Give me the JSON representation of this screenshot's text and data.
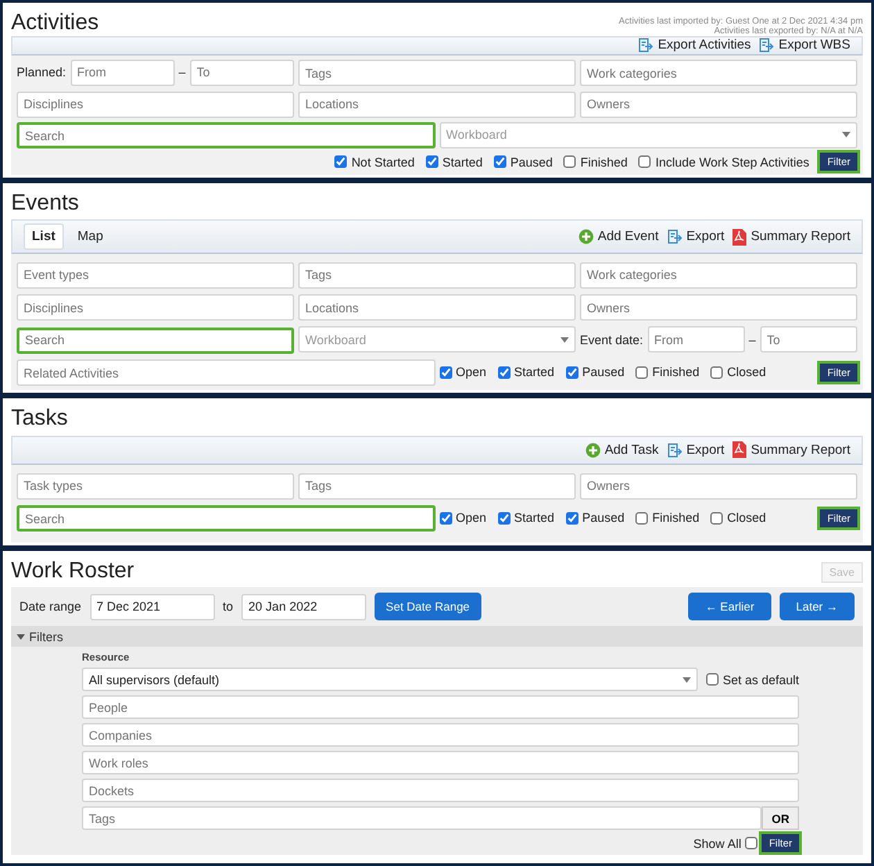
{
  "activities": {
    "title": "Activities",
    "notes": [
      "Activities last imported by: Guest One at 2 Dec 2021 4:34 pm",
      "Activities last exported by: N/A at N/A"
    ],
    "actions": [
      {
        "kind": "export",
        "label": "Export Activities"
      },
      {
        "kind": "export",
        "label": "Export WBS"
      }
    ],
    "planned_label": "Planned:",
    "dash": "–",
    "planned_from": {
      "placeholder": "From"
    },
    "planned_to": {
      "placeholder": "To"
    },
    "tags": {
      "placeholder": "Tags"
    },
    "work_categories": {
      "placeholder": "Work categories"
    },
    "disciplines": {
      "placeholder": "Disciplines"
    },
    "locations": {
      "placeholder": "Locations"
    },
    "owners": {
      "placeholder": "Owners"
    },
    "search": {
      "placeholder": "Search",
      "highlighted": true
    },
    "workboard": {
      "placeholder": "Workboard"
    },
    "statuses": [
      {
        "label": "Not Started",
        "checked": true
      },
      {
        "label": "Started",
        "checked": true
      },
      {
        "label": "Paused",
        "checked": true
      },
      {
        "label": "Finished",
        "checked": false
      },
      {
        "label": "Include Work Step Activities",
        "checked": false
      }
    ],
    "filter": {
      "label": "Filter",
      "highlighted": true
    }
  },
  "events": {
    "title": "Events",
    "views": [
      {
        "label": "List",
        "selected": true
      },
      {
        "label": "Map",
        "selected": false
      }
    ],
    "actions": [
      {
        "kind": "add",
        "label": "Add Event"
      },
      {
        "kind": "export",
        "label": "Export"
      },
      {
        "kind": "pdf",
        "label": "Summary Report"
      }
    ],
    "event_types": {
      "placeholder": "Event types"
    },
    "tags": {
      "placeholder": "Tags"
    },
    "work_categories": {
      "placeholder": "Work categories"
    },
    "disciplines": {
      "placeholder": "Disciplines"
    },
    "locations": {
      "placeholder": "Locations"
    },
    "owners": {
      "placeholder": "Owners"
    },
    "search": {
      "placeholder": "Search",
      "highlighted": true
    },
    "workboard": {
      "placeholder": "Workboard"
    },
    "event_date_label": "Event date:",
    "date_from": {
      "placeholder": "From"
    },
    "dash": "–",
    "date_to": {
      "placeholder": "To"
    },
    "related_activities": {
      "placeholder": "Related Activities"
    },
    "statuses": [
      {
        "label": "Open",
        "checked": true
      },
      {
        "label": "Started",
        "checked": true
      },
      {
        "label": "Paused",
        "checked": true
      },
      {
        "label": "Finished",
        "checked": false
      },
      {
        "label": "Closed",
        "checked": false
      }
    ],
    "filter": {
      "label": "Filter",
      "highlighted": true
    }
  },
  "tasks": {
    "title": "Tasks",
    "actions": [
      {
        "kind": "add",
        "label": "Add Task"
      },
      {
        "kind": "export",
        "label": "Export"
      },
      {
        "kind": "pdf",
        "label": "Summary Report"
      }
    ],
    "task_types": {
      "placeholder": "Task types"
    },
    "tags": {
      "placeholder": "Tags"
    },
    "owners": {
      "placeholder": "Owners"
    },
    "search": {
      "placeholder": "Search",
      "highlighted": true
    },
    "statuses": [
      {
        "label": "Open",
        "checked": true
      },
      {
        "label": "Started",
        "checked": true
      },
      {
        "label": "Paused",
        "checked": true
      },
      {
        "label": "Finished",
        "checked": false
      },
      {
        "label": "Closed",
        "checked": false
      }
    ],
    "filter": {
      "label": "Filter",
      "highlighted": true
    }
  },
  "roster": {
    "title": "Work Roster",
    "save": {
      "label": "Save",
      "disabled": true
    },
    "date_range_label": "Date range",
    "date_from": {
      "value": "7 Dec 2021"
    },
    "to_label": "to",
    "date_to": {
      "value": "20 Jan 2022"
    },
    "set_date_range": {
      "label": "Set Date Range"
    },
    "earlier": {
      "label": "← Earlier"
    },
    "later": {
      "label": "Later →"
    },
    "filters": {
      "label": "Filters",
      "expanded": true
    },
    "resource_label": "Resource",
    "resource": {
      "value": "All supervisors (default)"
    },
    "set_default": {
      "label": "Set as default",
      "checked": false
    },
    "people": {
      "placeholder": "People"
    },
    "companies": {
      "placeholder": "Companies"
    },
    "work_roles": {
      "placeholder": "Work roles"
    },
    "dockets": {
      "placeholder": "Dockets"
    },
    "tags": {
      "placeholder": "Tags"
    },
    "or": {
      "label": "OR"
    },
    "show_all": {
      "label": "Show All",
      "checked": false
    },
    "filter": {
      "label": "Filter",
      "highlighted": true
    }
  }
}
